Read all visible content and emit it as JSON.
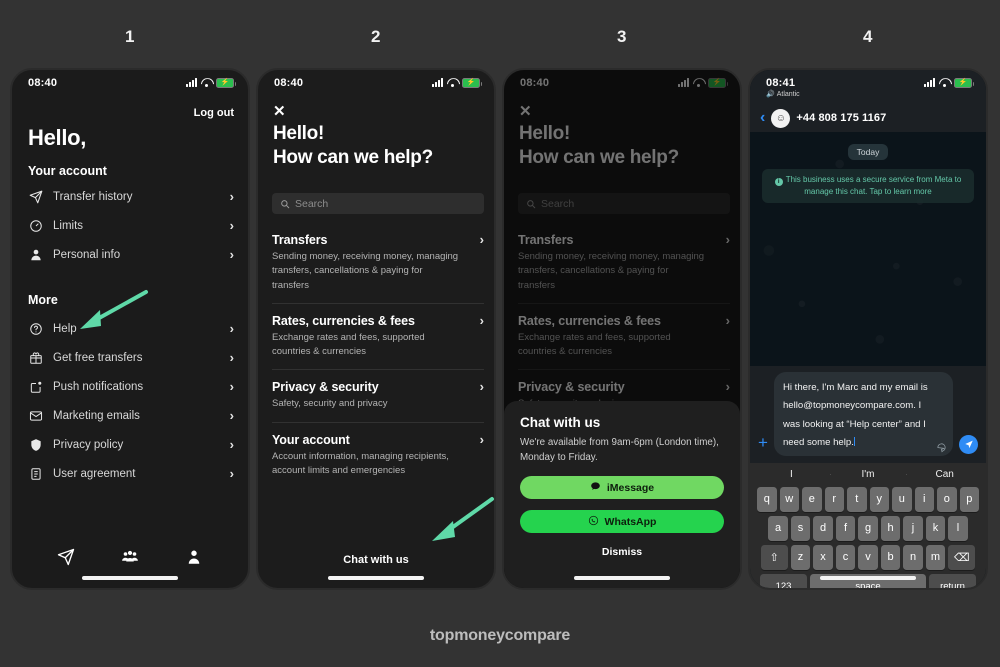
{
  "steps": [
    "1",
    "2",
    "3",
    "4"
  ],
  "watermark": "topmoneycompare",
  "colors": {
    "arrow": "#5FD9A8",
    "imessage": "#70D862",
    "whatsapp": "#25D34E",
    "wa_blue": "#2F8CF5",
    "battery": "#2BBF4E",
    "meta_notice": "#64C7A8"
  },
  "phone1": {
    "status": {
      "time": "08:40"
    },
    "logout": "Log out",
    "greeting": "Hello,",
    "section_account": "Your account",
    "account_items": [
      {
        "label": "Transfer history",
        "icon": "send-icon"
      },
      {
        "label": "Limits",
        "icon": "gauge-icon"
      },
      {
        "label": "Personal info",
        "icon": "person-icon"
      }
    ],
    "section_more": "More",
    "more_items": [
      {
        "label": "Help",
        "icon": "question-circle-icon"
      },
      {
        "label": "Get free transfers",
        "icon": "gift-icon"
      },
      {
        "label": "Push notifications",
        "icon": "notification-icon"
      },
      {
        "label": "Marketing emails",
        "icon": "envelope-icon"
      },
      {
        "label": "Privacy policy",
        "icon": "shield-icon"
      },
      {
        "label": "User agreement",
        "icon": "document-icon"
      }
    ],
    "tabs": [
      {
        "name": "send-tab",
        "icon": "paper-plane-icon"
      },
      {
        "name": "recipients-tab",
        "icon": "people-icon"
      },
      {
        "name": "account-tab",
        "icon": "person-icon"
      }
    ]
  },
  "phone2": {
    "status": {
      "time": "08:40"
    },
    "close": "✕",
    "title_line1": "Hello!",
    "title_line2": "How can we help?",
    "search": {
      "placeholder": "Search"
    },
    "topics": [
      {
        "title": "Transfers",
        "desc": "Sending money, receiving money, managing transfers, cancellations & paying for transfers"
      },
      {
        "title": "Rates, currencies & fees",
        "desc": "Exchange rates and fees, supported countries & currencies"
      },
      {
        "title": "Privacy & security",
        "desc": "Safety, security and privacy"
      },
      {
        "title": "Your account",
        "desc": "Account information, managing recipients, account limits and emergencies"
      }
    ],
    "chat_link": "Chat with us"
  },
  "phone3": {
    "status": {
      "time": "08:40"
    },
    "modal": {
      "title": "Chat with us",
      "desc": "We're available from 9am-6pm (London time), Monday to Friday.",
      "imessage_label": "iMessage",
      "whatsapp_label": "WhatsApp",
      "dismiss_label": "Dismiss"
    }
  },
  "phone4": {
    "status": {
      "time": "08:41",
      "carrier": "Atlantic"
    },
    "header": {
      "back": "‹",
      "number": "+44 808 175 1167"
    },
    "day_chip": "Today",
    "notice": "This business uses a secure service from Meta to manage this chat. Tap to learn more",
    "compose": {
      "text": "Hi there, I'm Marc and my email is hello@topmoneycompare.com. I was looking at “Help center” and I need some help."
    },
    "keyboard": {
      "suggestions": [
        "I",
        "I'm",
        "Can"
      ],
      "row1": [
        "q",
        "w",
        "e",
        "r",
        "t",
        "y",
        "u",
        "i",
        "o",
        "p"
      ],
      "row2": [
        "a",
        "s",
        "d",
        "f",
        "g",
        "h",
        "j",
        "k",
        "l"
      ],
      "row3": [
        "z",
        "x",
        "c",
        "v",
        "b",
        "n",
        "m"
      ],
      "shift": "⇧",
      "backspace": "⌫",
      "numbers": "123",
      "space": "space",
      "return": "return"
    }
  }
}
